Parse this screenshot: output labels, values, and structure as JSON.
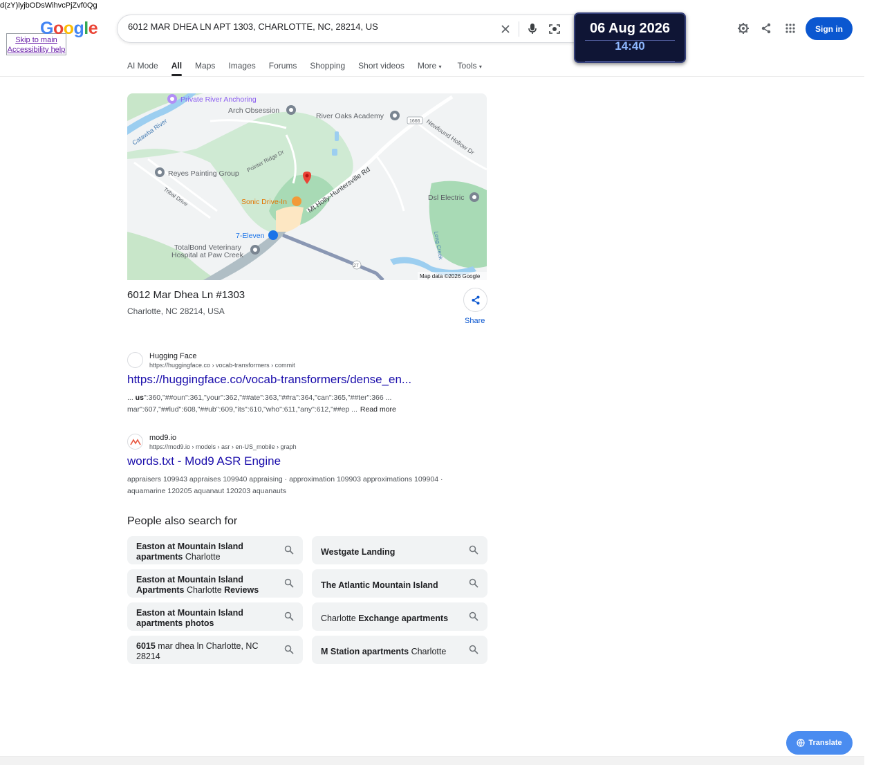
{
  "top_junk_text": "d(zY)lyjbODsWihvcPjZvf0Qg",
  "skip_links": {
    "line1": "Skip to main content",
    "line2": "Accessibility help"
  },
  "logo": {
    "letters": [
      "G",
      "o",
      "o",
      "g",
      "l",
      "e"
    ]
  },
  "search": {
    "value": "6012 MAR DHEA LN APT 1303, CHARLOTTE, NC, 28214, US"
  },
  "datetime": {
    "date": "06 Aug 2026",
    "time": "14:40"
  },
  "header": {
    "sign_in": "Sign in"
  },
  "tabs": [
    {
      "label": "AI Mode"
    },
    {
      "label": "All",
      "active": true
    },
    {
      "label": "Maps"
    },
    {
      "label": "Images"
    },
    {
      "label": "Forums"
    },
    {
      "label": "Shopping"
    },
    {
      "label": "Short videos"
    },
    {
      "label": "More"
    },
    {
      "label": "Tools"
    }
  ],
  "map": {
    "labels": {
      "private_river": "Private River Anchoring",
      "arch": "Arch Obsession",
      "river_oaks": "River Oaks Academy",
      "route_1666": "1666",
      "newfound": "Newfound Hollow Dr",
      "catawba": "Catawba River",
      "reyes": "Reyes Painting Group",
      "pointer": "Pointer Ridge Dr",
      "mt_holly": "Mt Holly-Huntersville Rd",
      "tribal": "Tribal Drive",
      "sonic": "Sonic Drive-In",
      "dsl": "Dsl Electric",
      "seven_eleven": "7-Eleven",
      "long_creek": "Long Creek",
      "totalbond1": "TotalBond Veterinary",
      "totalbond2": "Hospital at Paw Creek",
      "route_27": "27",
      "copyright": "Map data ©2026 Google"
    }
  },
  "place": {
    "line1": "6012 Mar Dhea Ln #1303",
    "line2": "Charlotte, NC 28214, USA",
    "share": "Share"
  },
  "results": [
    {
      "site": "Hugging Face",
      "crumb": "https://huggingface.co › vocab-transformers › commit",
      "title": "https://huggingface.co/vocab-transformers/dense_en...",
      "snippet1_pre": "... ",
      "snippet1_bold": "us",
      "snippet1_post": "\":360,\"##oun\":361,\"your\":362,\"##ate\":363,\"##ra\":364,\"can\":365,\"##ter\":366 ...",
      "snippet2": "mar\":607,\"##lud\":608,\"##ub\":609,\"its\":610,\"who\":611,\"any\":612,\"##ep ...",
      "read_more": "Read more"
    },
    {
      "site": "mod9.io",
      "crumb": "https://mod9.io › models › asr › en-US_mobile › graph",
      "title": "words.txt - Mod9 ASR Engine",
      "snippet1": "appraisers 109943 appraises 109940 appraising  ·  approximation 109903 approximations 109904  ·",
      "snippet2": "aquamarine 120205 aquanaut 120203 aquanauts"
    }
  ],
  "people_also_search": {
    "title": "People also search for",
    "items": [
      {
        "bold": "Easton at Mountain Island apartments",
        "rest": " Charlotte"
      },
      {
        "bold": "Westgate Landing",
        "rest": ""
      },
      {
        "bold": "Easton at Mountain Island Apartments",
        "rest": " Charlotte ",
        "bold2": "Reviews"
      },
      {
        "bold": "The Atlantic Mountain Island",
        "rest": ""
      },
      {
        "bold": "Easton at Mountain Island apartments photos",
        "rest": ""
      },
      {
        "pre": "Charlotte ",
        "bold": "Exchange apartments",
        "rest": ""
      },
      {
        "bold": "6015",
        "rest": " mar dhea ln Charlotte, NC 28214"
      },
      {
        "bold": "M Station apartments",
        "rest": " Charlotte"
      }
    ]
  },
  "translate": {
    "label": "Translate"
  },
  "colors": {
    "link": "#1a0dab",
    "accent": "#0b57d0",
    "pin": "#ea4335"
  }
}
